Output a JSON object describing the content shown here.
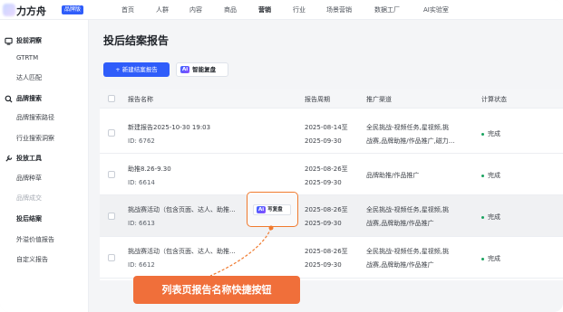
{
  "app": {
    "logo_text": "力方舟",
    "badge": "品牌版"
  },
  "nav": [
    "首页",
    "人群",
    "内容",
    "商品",
    "营销",
    "行业",
    "场景营销",
    "数据工厂",
    "AI实验室"
  ],
  "sidebar": {
    "groups": [
      {
        "label": "投前洞察",
        "icon": "insight-icon",
        "items": [
          "GTRTM",
          "达人匹配"
        ]
      },
      {
        "label": "品牌搜索",
        "icon": "search-icon",
        "items": [
          "品牌搜索路径",
          "行业搜索洞察"
        ]
      },
      {
        "label": "投放工具",
        "icon": "tool-icon",
        "items": [
          "品牌种草",
          "品牌成交",
          "投后结案",
          "外溢价值报告",
          "自定义报告"
        ]
      }
    ]
  },
  "page": {
    "title": "投后结案报告",
    "new_button": "+ 新建结案报告",
    "ai_chip": "Ai",
    "ai_button": "智能复盘"
  },
  "table": {
    "headers": [
      "报告名称",
      "报告周期",
      "推广渠道",
      "计算状态"
    ],
    "rows": [
      {
        "name": "新建报告2025-10-30 19:03",
        "id": "ID: 6762",
        "period_start": "2025-08-14至",
        "period_end": "2025-09-30",
        "channel_1": "全民挑战-视频任务,星视频,挑",
        "channel_2": "战赛,品牌助推/作品推广,磁力...",
        "status": "完成"
      },
      {
        "name": "助推8.26-9.30",
        "id": "ID: 6614",
        "period_start": "2025-08-26至",
        "period_end": "2025-09-30",
        "channel_1": "品牌助推/作品推广",
        "channel_2": "",
        "status": "完成"
      },
      {
        "name": "挑战赛活动（包含页面、达人、助推...",
        "id": "ID: 6613",
        "period_start": "2025-08-26至",
        "period_end": "2025-09-30",
        "channel_1": "全民挑战-视频任务,星视频,挑",
        "channel_2": "战赛,品牌助推/作品推广",
        "status": "完成"
      },
      {
        "name": "挑战赛活动（包含页面、达人、助推...",
        "id": "ID: 6612",
        "period_start": "2025-08-26至",
        "period_end": "2025-09-30",
        "channel_1": "全民挑战-视频任务,星视频,挑",
        "channel_2": "战赛,品牌助推/作品推广",
        "status": "完成"
      }
    ]
  },
  "review_button": {
    "chip": "Ai",
    "label": "写复盘"
  },
  "callout": "列表页报告名称快捷按钮",
  "colors": {
    "accent": "#2f5dfa",
    "highlight": "#f06f3a",
    "status": "#1aa35f"
  }
}
